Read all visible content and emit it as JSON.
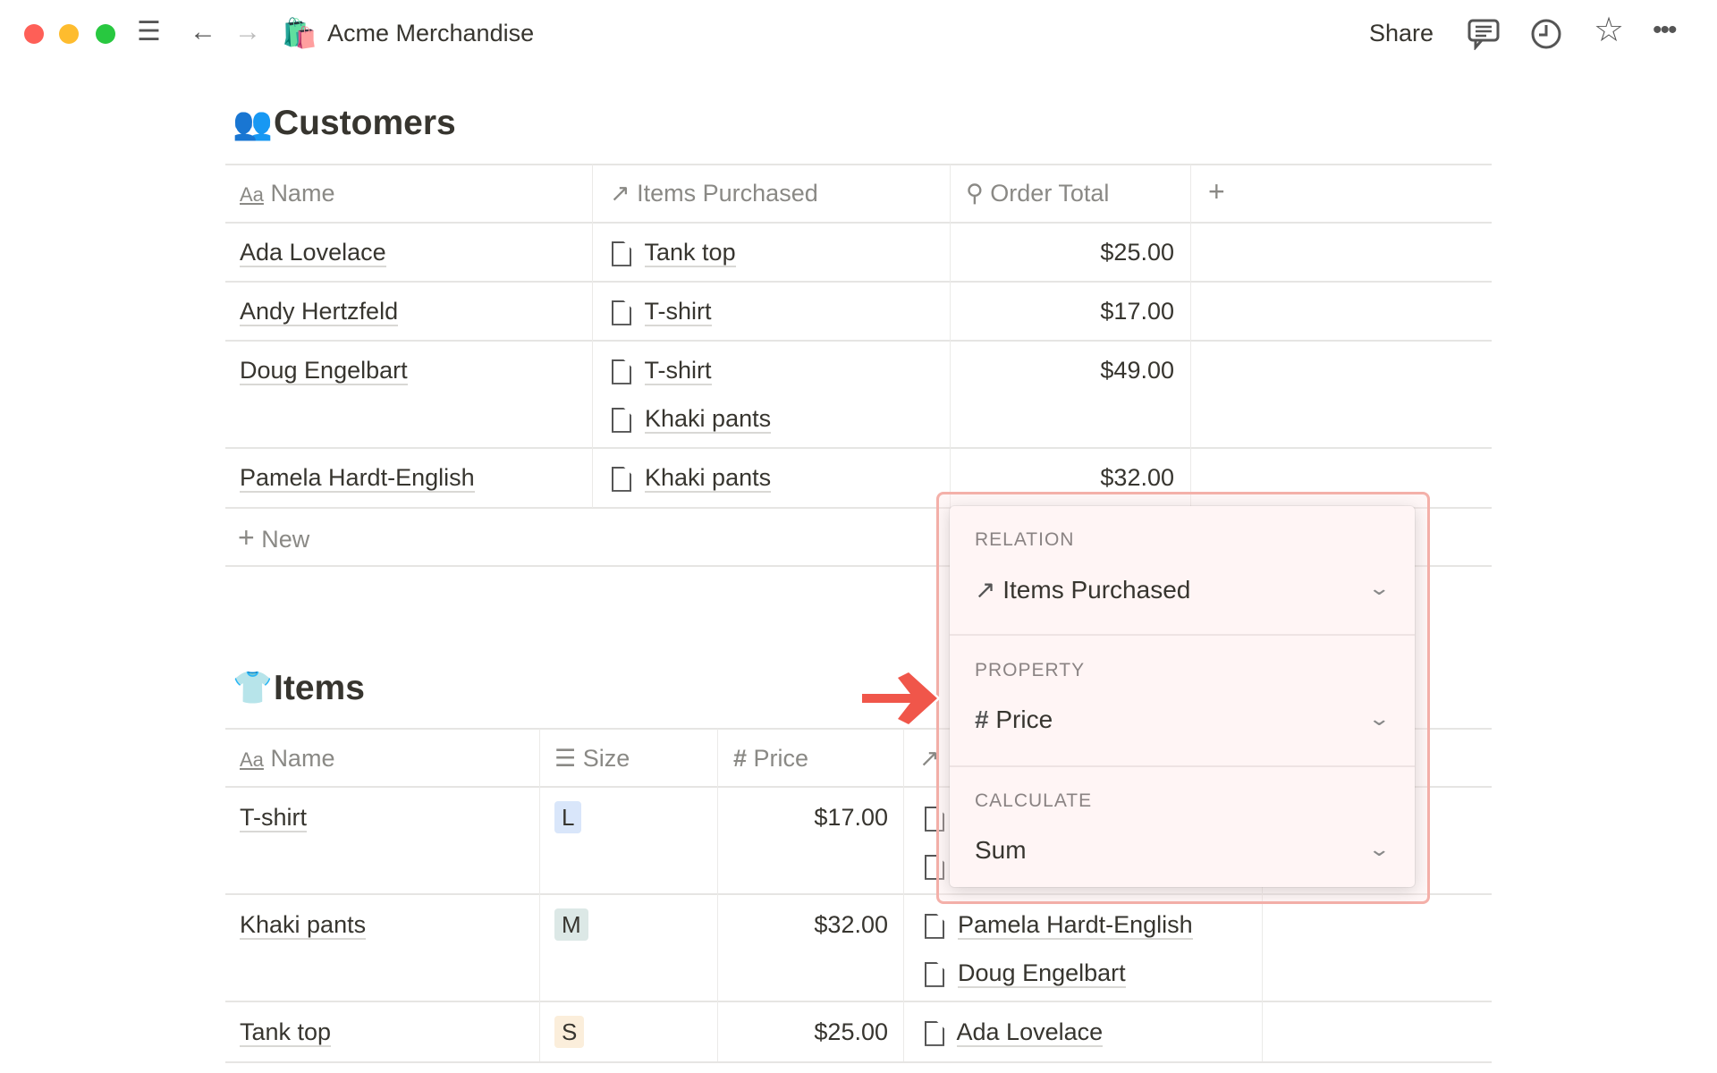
{
  "titlebar": {
    "title": "Acme Merchandise",
    "emoji": "🛍️",
    "share": "Share",
    "icons": [
      "menu-icon",
      "back-arrow-icon",
      "forward-arrow-icon",
      "comment-icon",
      "clock-icon",
      "star-icon",
      "more-icon"
    ]
  },
  "customers": {
    "emoji": "👥",
    "title": "Customers",
    "columns": {
      "name": "Name",
      "items": "Items Purchased",
      "total": "Order Total",
      "add": "+"
    },
    "rows": [
      {
        "name": "Ada Lovelace",
        "items": [
          "Tank top"
        ],
        "total": "$25.00"
      },
      {
        "name": "Andy Hertzfeld",
        "items": [
          "T-shirt"
        ],
        "total": "$17.00"
      },
      {
        "name": "Doug Engelbart",
        "items": [
          "T-shirt",
          "Khaki pants"
        ],
        "total": "$49.00"
      },
      {
        "name": "Pamela Hardt-English",
        "items": [
          "Khaki pants"
        ],
        "total": "$32.00"
      }
    ],
    "new_label": "New"
  },
  "items": {
    "emoji": "👕",
    "title": "Items",
    "columns": {
      "name": "Name",
      "size": "Size",
      "price": "Price"
    },
    "rows": [
      {
        "name": "T-shirt",
        "size": "L",
        "size_color": "#d9e6fa",
        "price": "$17.00",
        "customers": []
      },
      {
        "name": "Khaki pants",
        "size": "M",
        "size_color": "#dce8e6",
        "price": "$32.00",
        "customers": [
          "Pamela Hardt-English",
          "Doug Engelbart"
        ]
      },
      {
        "name": "Tank top",
        "size": "S",
        "size_color": "#fbeedb",
        "price": "$25.00",
        "customers": [
          "Ada Lovelace"
        ]
      }
    ]
  },
  "rollup_popup": {
    "relation_label": "RELATION",
    "relation_value": "Items Purchased",
    "property_label": "PROPERTY",
    "property_value": "Price",
    "calculate_label": "CALCULATE",
    "calculate_value": "Sum",
    "highlight_color": "#f4a8a0",
    "arrow_color": "#f0564a"
  }
}
